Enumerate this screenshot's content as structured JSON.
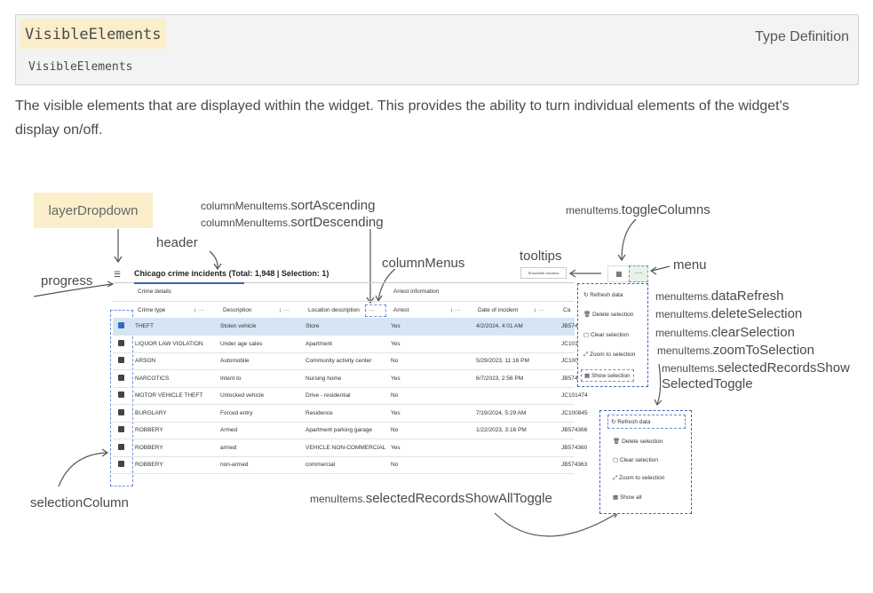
{
  "type_header": {
    "name": "VisibleElements",
    "name_sub": "VisibleElements",
    "kind": "Type Definition"
  },
  "description": "The visible elements that are displayed within the widget. This provides the ability to turn individual elements of the widget's display on/off.",
  "labels": {
    "layerDropdown": "layerDropdown",
    "header": "header",
    "progress": "progress",
    "sortAscending_prefix": "columnMenuItems.",
    "sortAscending": "sortAscending",
    "sortDescending_prefix": "columnMenuItems.",
    "sortDescending": "sortDescending",
    "columnMenus": "columnMenus",
    "tooltips": "tooltips",
    "toggleColumns_prefix": "menuItems.",
    "toggleColumns": "toggleColumns",
    "menu": "menu",
    "dataRefresh_prefix": "menuItems.",
    "dataRefresh": "dataRefresh",
    "deleteSelection_prefix": "menuItems.",
    "deleteSelection": "deleteSelection",
    "clearSelection_prefix": "menuItems.",
    "clearSelection": "clearSelection",
    "zoomToSelection_prefix": "menuItems.",
    "zoomToSelection": "zoomToSelection",
    "showSelected_prefix": "menuItems.",
    "showSelected_1": "selectedRecordsShow",
    "showSelected_2": "SelectedToggle",
    "showAll_prefix": "menuItems.",
    "showAll": "selectedRecordsShowAllToggle",
    "selectionColumn": "selectionColumn"
  },
  "table": {
    "title": "Chicago crime incidents (Total: 1,948 | Selection: 1)",
    "group1": "Crime details",
    "group2": "Arrest information",
    "tooltip": "Show/hide columns",
    "columns": [
      "Crime type",
      "Description",
      "Location description",
      "Arrest",
      "Date of incident",
      "Ca"
    ],
    "rows": [
      {
        "type": "THEFT",
        "desc": "Stolen vehicle",
        "loc": "Store",
        "arrest": "Yes",
        "date": "4/2/2024, 4:01 AM",
        "case": "JB574",
        "selected": true
      },
      {
        "type": "LIQUOR LAW VIOLATION",
        "desc": "Under age sales",
        "loc": "Apartment",
        "arrest": "Yes",
        "date": "",
        "case": "JC101",
        "selected": false
      },
      {
        "type": "ARSON",
        "desc": "Automobile",
        "loc": "Community activity center",
        "arrest": "No",
        "date": "5/29/2023, 11:16 PM",
        "case": "JC100",
        "selected": false
      },
      {
        "type": "NARCOTICS",
        "desc": "Intent to",
        "loc": "Nursing home",
        "arrest": "Yes",
        "date": "6/7/2023, 2:56 PM",
        "case": "JB574",
        "selected": false
      },
      {
        "type": "MOTOR VEHICLE THEFT",
        "desc": "Unlocked vehicle",
        "loc": "Drive - residential",
        "arrest": "No",
        "date": "",
        "case": "JC101474",
        "selected": false
      },
      {
        "type": "BURGLARY",
        "desc": "Forced entry",
        "loc": "Residence",
        "arrest": "Yes",
        "date": "7/19/2024, 5:29 AM",
        "case": "JC100845",
        "selected": false
      },
      {
        "type": "ROBBERY",
        "desc": "Armed",
        "loc": "Apartment parking garage",
        "arrest": "No",
        "date": "1/22/2023, 3:16 PM",
        "case": "JB574366",
        "selected": false
      },
      {
        "type": "ROBBERY",
        "desc": "armed",
        "loc": "VEHICLE NON-COMMERCIAL",
        "arrest": "Yes",
        "date": "",
        "case": "JB574360",
        "selected": false
      },
      {
        "type": "ROBBERY",
        "desc": "non-armed",
        "loc": "commercial",
        "arrest": "No",
        "date": "",
        "case": "JB574363",
        "selected": false
      }
    ]
  },
  "menu1": [
    "Refresh data",
    "Delete selection",
    "Clear selection",
    "Zoom to selection",
    "Show selection"
  ],
  "menu2": [
    "Refresh data",
    "Delete selection",
    "Clear selection",
    "Zoom to selection",
    "Show all"
  ],
  "icons": {
    "layer": "layers-icon",
    "columns": "columns-icon",
    "more": "ellipsis-icon"
  }
}
